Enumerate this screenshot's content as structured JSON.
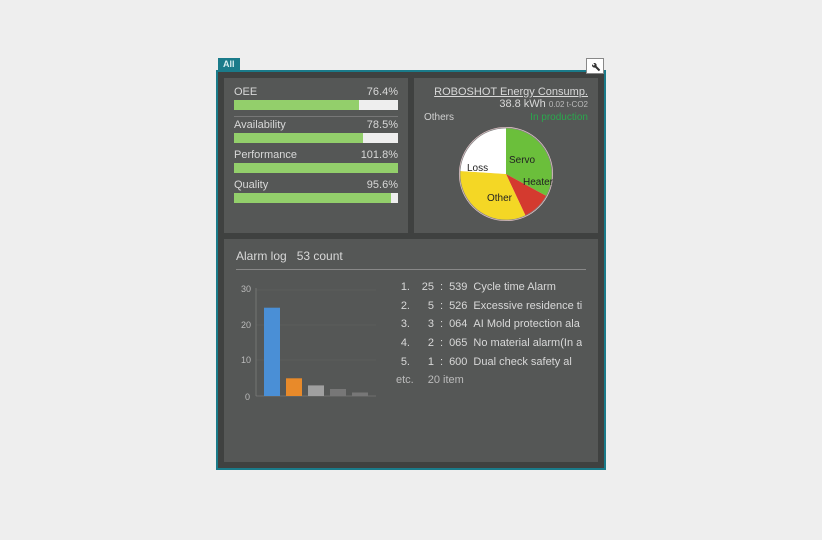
{
  "tab": "All",
  "metrics": {
    "oee": {
      "label": "OEE",
      "value": "76.4%",
      "pct": 76.4
    },
    "availability": {
      "label": "Availability",
      "value": "78.5%",
      "pct": 78.5
    },
    "performance": {
      "label": "Performance",
      "value": "101.8%",
      "pct": 100
    },
    "quality": {
      "label": "Quality",
      "value": "95.6%",
      "pct": 95.6
    }
  },
  "energy": {
    "title": "ROBOSHOT Energy Consump.",
    "kwh": "38.8 kWh",
    "co2": "0.02 t-CO2",
    "legend_left": "Others",
    "legend_right": "In production",
    "slices": {
      "servo": {
        "label": "Servo",
        "color": "#6bbf3b"
      },
      "heater": {
        "label": "Heater",
        "color": "#d43a2f"
      },
      "other": {
        "label": "Other",
        "color": "#f4d725"
      },
      "loss": {
        "label": "Loss",
        "color": "#ffffff"
      }
    }
  },
  "alarm": {
    "title": "Alarm log",
    "count_text": "53 count",
    "items": [
      {
        "rank": "1.",
        "count": "25",
        "code": "539",
        "desc": "Cycle time Alarm"
      },
      {
        "rank": "2.",
        "count": "5",
        "code": "526",
        "desc": "Excessive residence ti"
      },
      {
        "rank": "3.",
        "count": "3",
        "code": "064",
        "desc": "AI Mold protection ala"
      },
      {
        "rank": "4.",
        "count": "2",
        "code": "065",
        "desc": "No material alarm(In a"
      },
      {
        "rank": "5.",
        "count": "1",
        "code": "600",
        "desc": "Dual check safety al"
      }
    ],
    "etc_label": "etc.",
    "etc_count": "20 item"
  },
  "chart_data": [
    {
      "type": "bar",
      "title": "OEE metrics",
      "categories": [
        "OEE",
        "Availability",
        "Performance",
        "Quality"
      ],
      "values": [
        76.4,
        78.5,
        101.8,
        95.6
      ],
      "ylim": [
        0,
        110
      ]
    },
    {
      "type": "pie",
      "title": "ROBOSHOT Energy Consump.",
      "series": [
        {
          "name": "Servo",
          "value": 33,
          "color": "#6bbf3b"
        },
        {
          "name": "Heater",
          "value": 10,
          "color": "#d43a2f"
        },
        {
          "name": "Other",
          "value": 33,
          "color": "#f4d725"
        },
        {
          "name": "Loss",
          "value": 24,
          "color": "#ffffff"
        }
      ]
    },
    {
      "type": "bar",
      "title": "Alarm log",
      "categories": [
        "1",
        "2",
        "3",
        "4",
        "5"
      ],
      "values": [
        25,
        5,
        3,
        2,
        1
      ],
      "ylim": [
        0,
        30
      ],
      "colors": [
        "#4a8fd6",
        "#e88a2a",
        "#a0a0a0",
        "#777777",
        "#777777"
      ]
    }
  ]
}
